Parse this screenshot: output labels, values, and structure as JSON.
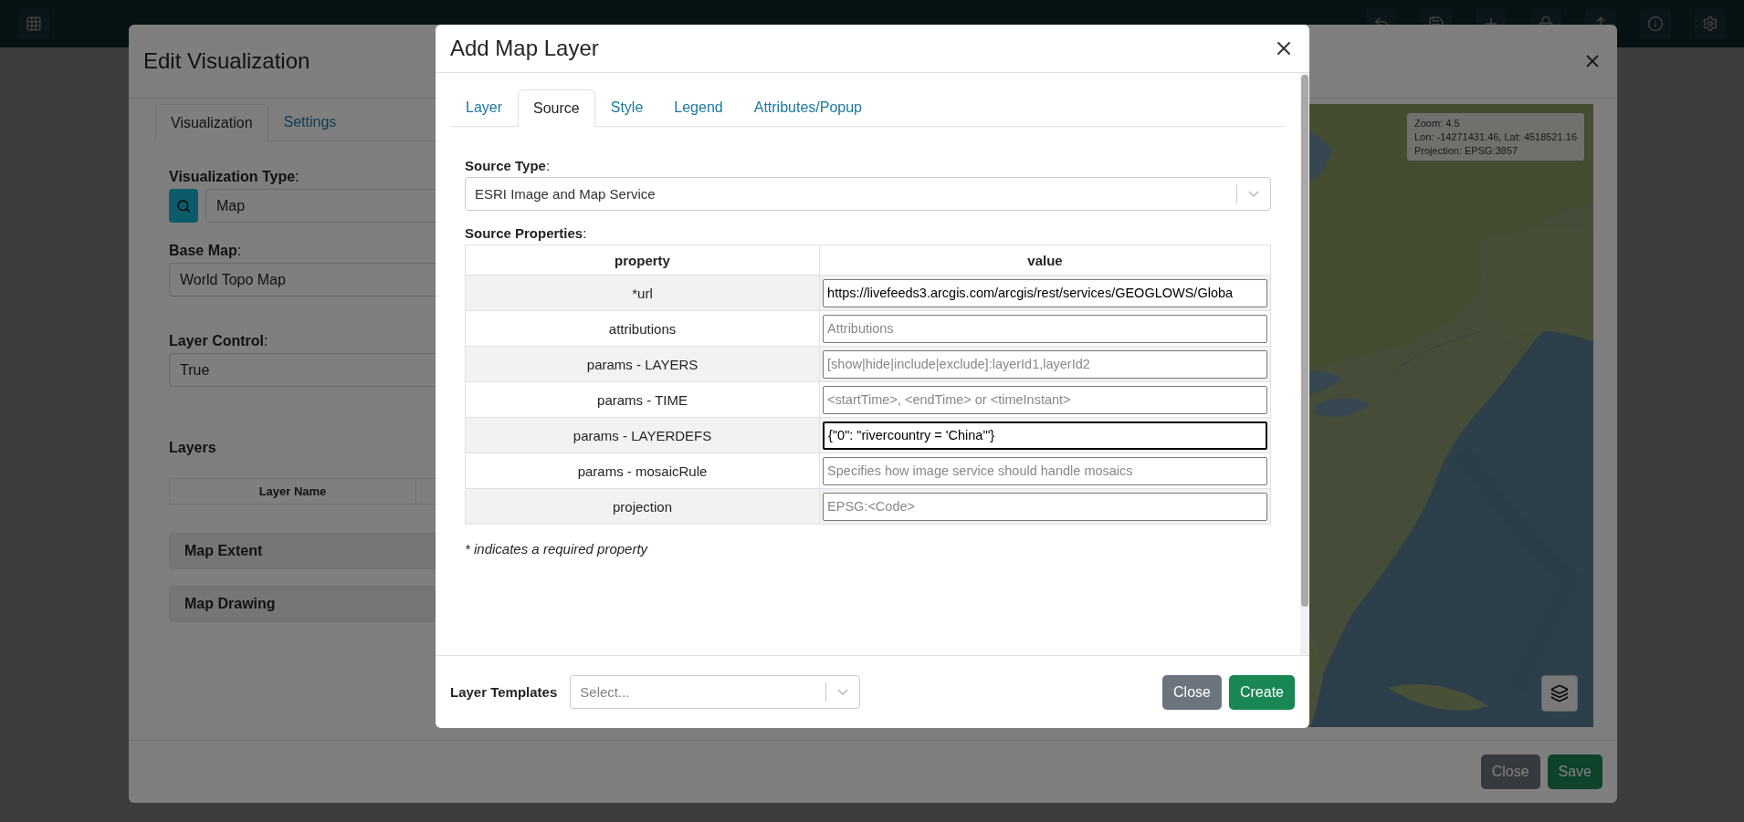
{
  "edit_dialog": {
    "title": "Edit Visualization",
    "tabs": [
      {
        "label": "Visualization",
        "selected": true
      },
      {
        "label": "Settings",
        "selected": false
      }
    ],
    "fields": [
      {
        "kind": "search",
        "label": "**Visualization Type**:",
        "value": "Map"
      },
      {
        "kind": "select",
        "label": "**Base Map**:",
        "value": "World Topo Map"
      },
      {
        "kind": "select",
        "label": "**Layer Control**:",
        "value": "True"
      }
    ],
    "layers": {
      "title": "Layers",
      "columns": [
        "Layer Name"
      ]
    },
    "sections": [
      "Map Extent",
      "Map Drawing"
    ],
    "map": {
      "kind": "picture",
      "info": [
        "Zoom: 4.5",
        "Lon: -14271431.46, Lat: 4518521.16",
        "Projection: EPSG:3857"
      ]
    },
    "buttons": [
      {
        "label": "Close",
        "kind": "secondary"
      },
      {
        "label": "Save",
        "kind": "primary"
      }
    ]
  },
  "add_layer_dialog": {
    "title": "Add Map Layer",
    "tabs": [
      {
        "label": "Layer",
        "selected": false
      },
      {
        "label": "Source",
        "selected": true
      },
      {
        "label": "Style",
        "selected": false
      },
      {
        "label": "Legend",
        "selected": false
      },
      {
        "label": "Attributes/Popup",
        "selected": false
      }
    ],
    "source_type": {
      "label": "**Source Type**:",
      "value": "ESRI Image and Map Service"
    },
    "source_properties": {
      "label": "**Source Properties**:",
      "columns": [
        "property",
        "value"
      ],
      "rows": [
        {
          "property": "*url",
          "value": "https://livefeeds3.arcgis.com/arcgis/rest/services/GEOGLOWS/Globa",
          "focused": false
        },
        {
          "property": "attributions",
          "placeholder": "Attributions",
          "focused": false
        },
        {
          "property": "params - LAYERS",
          "placeholder": "[show|hide|include|exclude]:layerId1,layerId2",
          "focused": false
        },
        {
          "property": "params - TIME",
          "placeholder": "<startTime>, <endTime> or <timeInstant>",
          "focused": false
        },
        {
          "property": "params - LAYERDEFS",
          "value": "{\"0\": \"rivercountry = 'China'\"}",
          "focused": true
        },
        {
          "property": "params - mosaicRule",
          "placeholder": "Specifies how image service should handle mosaics",
          "focused": false
        },
        {
          "property": "projection",
          "placeholder": "EPSG:<Code>",
          "focused": false
        }
      ]
    },
    "footnote": "* indicates a required property",
    "layer_templates": {
      "label": "Layer Templates",
      "placeholder": "Select..."
    },
    "buttons": [
      {
        "label": "Close",
        "kind": "secondary"
      },
      {
        "label": "Create",
        "kind": "primary"
      }
    ]
  }
}
